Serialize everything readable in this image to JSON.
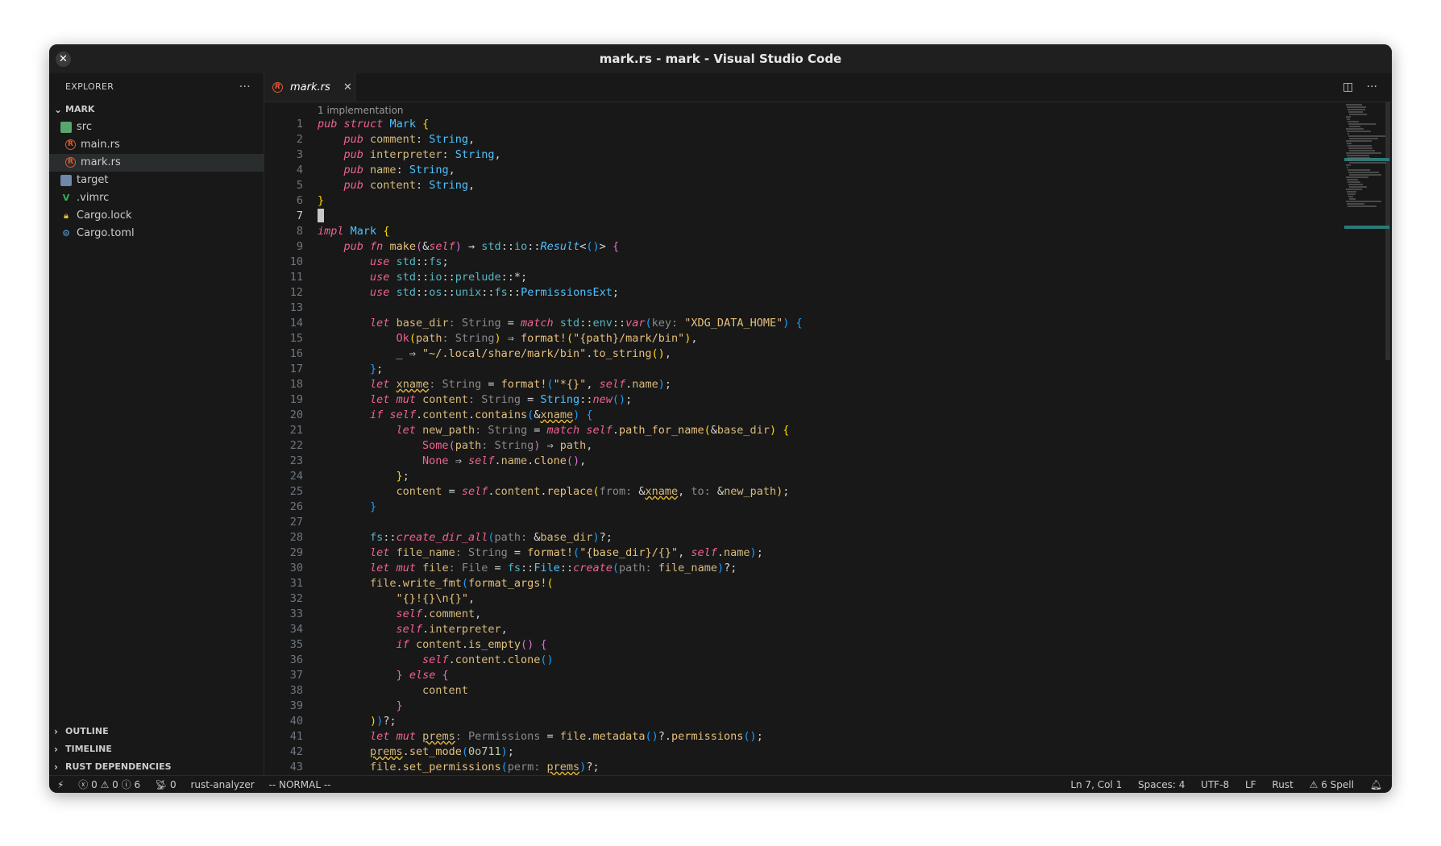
{
  "window": {
    "title": "mark.rs - mark - Visual Studio Code"
  },
  "sidebar": {
    "header": "EXPLORER",
    "header_actions": "···",
    "root": "MARK",
    "items": [
      {
        "label": "src",
        "icon": "folder-src-icon"
      },
      {
        "label": "main.rs",
        "icon": "rust-file-icon"
      },
      {
        "label": "mark.rs",
        "icon": "rust-file-icon"
      },
      {
        "label": "target",
        "icon": "folder-target-icon"
      },
      {
        "label": ".vimrc",
        "icon": "vim-icon"
      },
      {
        "label": "Cargo.lock",
        "icon": "lock-icon"
      },
      {
        "label": "Cargo.toml",
        "icon": "gear-icon"
      }
    ],
    "sections": [
      "OUTLINE",
      "TIMELINE",
      "RUST DEPENDENCIES"
    ]
  },
  "tab": {
    "label": "mark.rs",
    "close": "✕"
  },
  "editor": {
    "codelens": "1 implementation",
    "line_numbers": [
      "1",
      "2",
      "3",
      "4",
      "5",
      "6",
      "7",
      "8",
      "9",
      "10",
      "11",
      "12",
      "13",
      "14",
      "15",
      "16",
      "17",
      "18",
      "19",
      "20",
      "21",
      "22",
      "23",
      "24",
      "25",
      "26",
      "27",
      "28",
      "29",
      "30",
      "31",
      "32",
      "33",
      "34",
      "35",
      "36",
      "37",
      "38",
      "39",
      "40",
      "41",
      "42",
      "43"
    ],
    "current_line": 7
  },
  "statusbar": {
    "problems_errors": "0",
    "problems_warnings": "0",
    "problems_info": "6",
    "ports": "0",
    "language_server": "rust-analyzer",
    "vim_mode": "-- NORMAL --",
    "cursor_position": "Ln 7, Col 1",
    "indentation": "Spaces: 4",
    "encoding": "UTF-8",
    "eol": "LF",
    "language": "Rust",
    "spell": "6 Spell"
  }
}
